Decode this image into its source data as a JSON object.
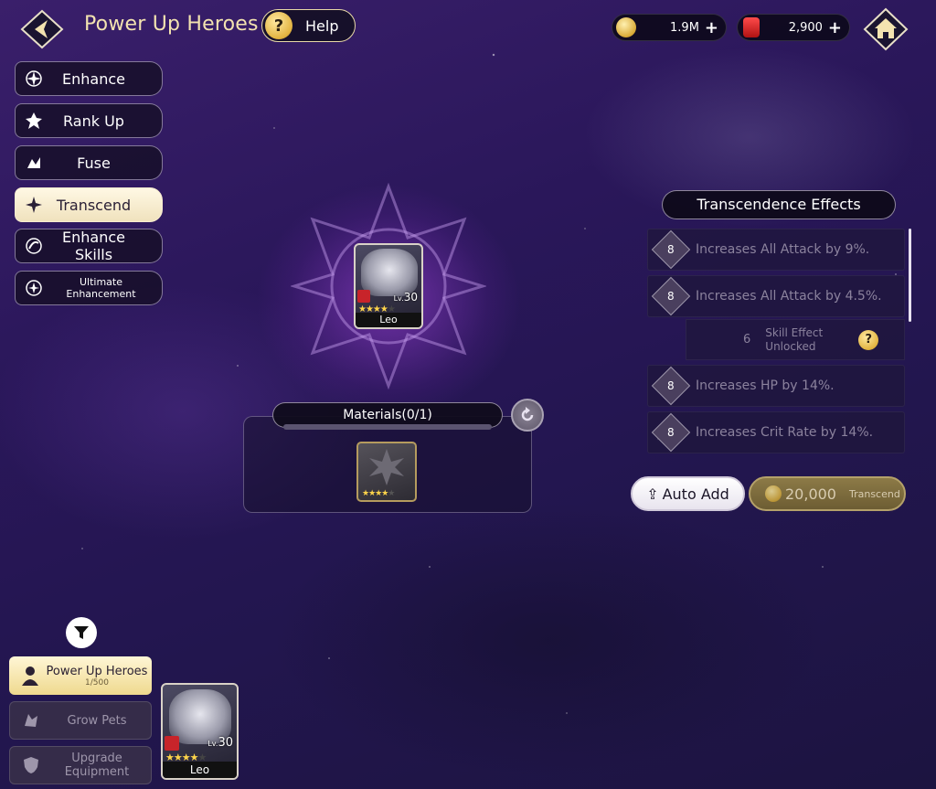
{
  "header": {
    "title": "Power Up Heroes",
    "help_label": "Help",
    "help_symbol": "?"
  },
  "currency": {
    "gold": "1.9M",
    "gems": "2,900",
    "plus": "+"
  },
  "menu": {
    "items": [
      {
        "label": "Enhance",
        "icon": "compass-star-icon",
        "active": false
      },
      {
        "label": "Rank Up",
        "icon": "rank-up-icon",
        "active": false
      },
      {
        "label": "Fuse",
        "icon": "fuse-icon",
        "active": false
      },
      {
        "label": "Transcend",
        "icon": "transcend-icon",
        "active": true
      },
      {
        "label": "Enhance Skills",
        "icon": "skill-orb-icon",
        "active": false
      },
      {
        "label": "Ultimate Enhancement",
        "icon": "ultimate-icon",
        "active": false
      }
    ]
  },
  "hero": {
    "name": "Leo",
    "level_prefix": "Lv.",
    "level": "30",
    "stars_filled": 4,
    "stars_total": 5
  },
  "materials": {
    "label": "Materials(0/1)",
    "slot_stars_filled": 4,
    "slot_stars_total": 5
  },
  "effects": {
    "title": "Transcendence Effects",
    "rows": [
      {
        "level": "8",
        "text": "Increases All Attack by 9%."
      },
      {
        "level": "8",
        "text": "Increases All Attack by 4.5%."
      },
      {
        "level": "8",
        "text": "Increases HP by 14%."
      },
      {
        "level": "8",
        "text": "Increases Crit Rate by 14%."
      }
    ],
    "skill_unlock": {
      "count": "6",
      "text": "Skill Effect Unlocked",
      "help_symbol": "?"
    }
  },
  "actions": {
    "auto_add_label": "Auto Add",
    "transcend_cost": "20,000",
    "transcend_label": "Transcend"
  },
  "bottom": {
    "tabs": [
      {
        "label": "Power Up Heroes",
        "count": "1/500",
        "active": true
      },
      {
        "label": "Grow Pets",
        "active": false
      },
      {
        "label": "Upgrade Equipment",
        "active": false
      }
    ],
    "list_hero": {
      "name": "Leo",
      "level_prefix": "Lv.",
      "level": "30"
    }
  },
  "colors": {
    "accent_gold": "#e2b340",
    "active_tab": "#fff8e4",
    "background": "#2a175a"
  }
}
